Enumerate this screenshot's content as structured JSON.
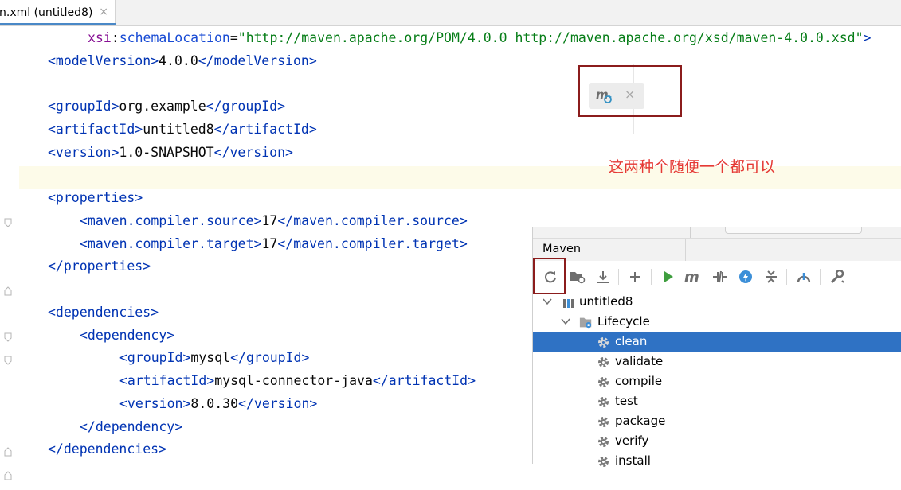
{
  "editor_tab": {
    "label": "n.xml (untitled8)",
    "close": "×"
  },
  "code": {
    "line1": {
      "ns": "xsi",
      "colon": ":",
      "attr": "schemaLocation",
      "eq": "=",
      "value": "\"http://maven.apache.org/POM/4.0.0 http://maven.apache.org/xsd/maven-4.0.0.xsd\"",
      "end": ">"
    },
    "line2": {
      "open": "<modelVersion>",
      "text": "4.0.0",
      "close": "</modelVersion>"
    },
    "line3": {
      "open": "<groupId>",
      "text": "org.example",
      "close": "</groupId>"
    },
    "line4": {
      "open": "<artifactId>",
      "text": "untitled8",
      "close": "</artifactId>"
    },
    "line5": {
      "open": "<version>",
      "text": "1.0-SNAPSHOT",
      "close": "</version>"
    },
    "line6": {
      "open": "<properties>"
    },
    "line7": {
      "open": "<maven.compiler.source>",
      "text": "17",
      "close": "</maven.compiler.source>"
    },
    "line8": {
      "open": "<maven.compiler.target>",
      "text": "17",
      "close": "</maven.compiler.target>"
    },
    "line9": {
      "close": "</properties>"
    },
    "line10": {
      "open": "<dependencies>"
    },
    "line11": {
      "open": "<dependency>"
    },
    "line12": {
      "open": "<groupId>",
      "text": "mysql",
      "close": "</groupId>"
    },
    "line13": {
      "open": "<artifactId>",
      "text": "mysql-connector-java",
      "close": "</artifactId>"
    },
    "line14": {
      "open": "<version>",
      "text": "8.0.30",
      "close": "</version>"
    },
    "line15": {
      "close": "</dependency>"
    },
    "line16": {
      "close": "</dependencies>"
    }
  },
  "reload_popup": {
    "icon": "maven-reload-icon",
    "close": "×"
  },
  "annotation": "这两种个随便一个都可以",
  "maven_panel": {
    "title": "Maven",
    "toolbar": [
      {
        "name": "reload-all-projects",
        "icon": "refresh-icon"
      },
      {
        "name": "generate-sources",
        "icon": "folder-refresh-icon"
      },
      {
        "name": "download-sources",
        "icon": "download-icon"
      },
      {
        "name": "add-maven-project",
        "icon": "plus-icon"
      },
      {
        "name": "run-maven-build",
        "icon": "run-icon"
      },
      {
        "name": "execute-maven-goal",
        "icon": "maven-m-icon"
      },
      {
        "name": "toggle-offline-mode",
        "icon": "offline-icon"
      },
      {
        "name": "skip-tests",
        "icon": "lightning-icon"
      },
      {
        "name": "collapse-all",
        "icon": "collapse-icon"
      },
      {
        "name": "show-dependencies",
        "icon": "dependencies-icon"
      },
      {
        "name": "maven-settings",
        "icon": "wrench-icon"
      }
    ],
    "tree": {
      "project": "untitled8",
      "lifecycle": "Lifecycle",
      "goals": [
        "clean",
        "validate",
        "compile",
        "test",
        "package",
        "verify",
        "install"
      ],
      "selected": "clean"
    }
  },
  "colors": {
    "tag": "#0033b3",
    "string": "#067d17",
    "namespace": "#871094",
    "annotation": "#e53935",
    "selection": "#2f72c4",
    "highlight_box": "#8b1c1c"
  }
}
